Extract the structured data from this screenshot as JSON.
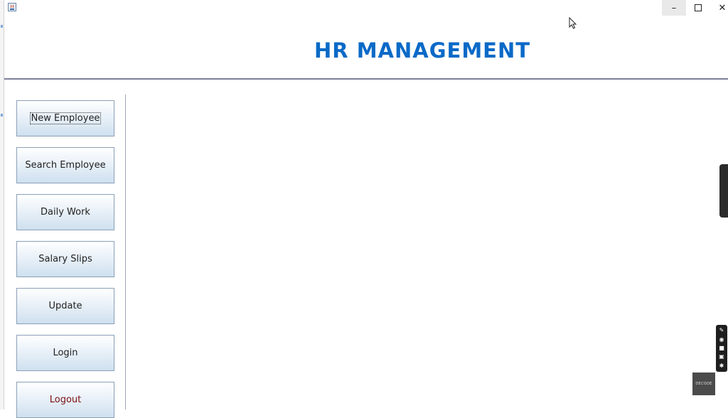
{
  "window": {
    "controls": {
      "minimize_label": "–",
      "close_label": "✕"
    }
  },
  "header": {
    "title": "HR MANAGEMENT",
    "title_color": "#0a6ac7"
  },
  "sidebar": {
    "items": [
      {
        "label": "New Employee"
      },
      {
        "label": "Search Employee"
      },
      {
        "label": "Daily Work"
      },
      {
        "label": "Salary Slips"
      },
      {
        "label": "Update"
      },
      {
        "label": "Login"
      },
      {
        "label": "Logout"
      }
    ]
  },
  "overlay": {
    "watermark_text": "DECODE"
  },
  "colors": {
    "button_border": "#8aa0b8",
    "logout_text": "#7a1010"
  }
}
